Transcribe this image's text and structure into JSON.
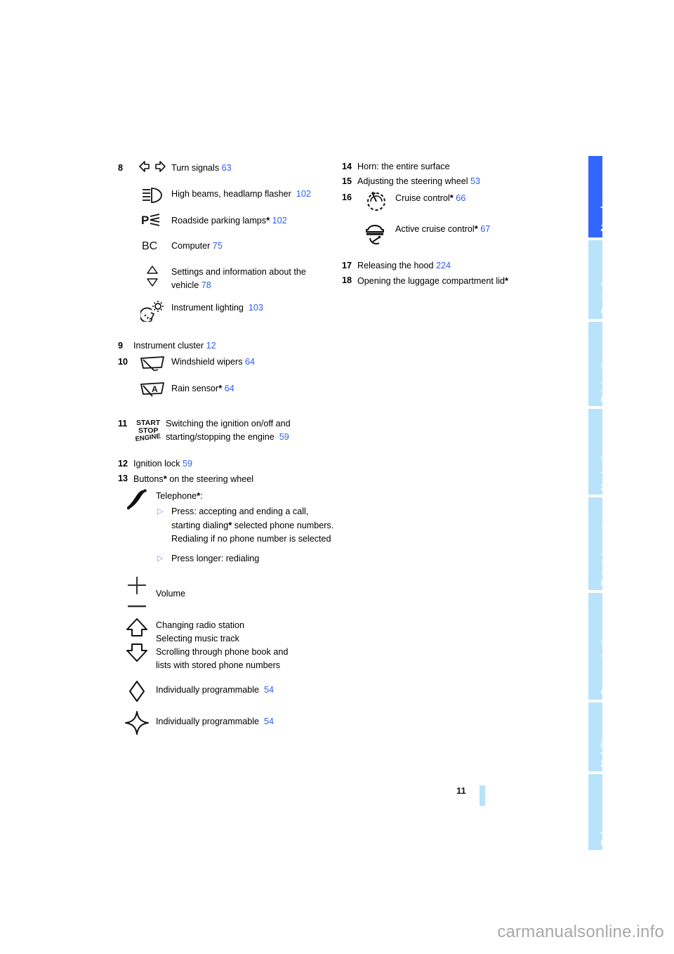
{
  "document": {
    "page_number": "11",
    "watermark": "carmanualsonline.info"
  },
  "sidebar": {
    "tabs": [
      {
        "label": "At a glance",
        "active": true
      },
      {
        "label": "Controls",
        "active": false
      },
      {
        "label": "Driving tips",
        "active": false
      },
      {
        "label": "Navigation",
        "active": false
      },
      {
        "label": "Entertainment",
        "active": false
      },
      {
        "label": "Communications",
        "active": false
      },
      {
        "label": "Mobility",
        "active": false
      },
      {
        "label": "Reference",
        "active": false
      }
    ],
    "active_color": "#3366ff",
    "inactive_color": "#b9e2fb"
  },
  "left_column": {
    "item8": {
      "number": "8",
      "entries": [
        {
          "icon": "turn-signals-icon",
          "text": "Turn signals",
          "page": "63",
          "starred": false
        },
        {
          "icon": "high-beam-icon",
          "text": "High beams, headlamp flasher",
          "page": "102",
          "starred": false
        },
        {
          "icon": "parking-lamp-icon",
          "text": "Roadside parking lamps",
          "page": "102",
          "starred": true
        },
        {
          "icon": "bc-computer-icon",
          "text": "Computer",
          "page": "75",
          "starred": false
        },
        {
          "icon": "up-down-arrows-icon",
          "text": "Settings and information about the vehicle",
          "page": "78",
          "starred": false
        },
        {
          "icon": "instrument-lighting-icon",
          "text": "Instrument lighting",
          "page": "103",
          "starred": false
        }
      ]
    },
    "item9": {
      "number": "9",
      "text": "Instrument cluster",
      "page": "12"
    },
    "item10": {
      "number": "10",
      "entries": [
        {
          "icon": "wiper-icon",
          "text": "Windshield wipers",
          "page": "64",
          "starred": false
        },
        {
          "icon": "rain-sensor-icon",
          "text": "Rain sensor",
          "page": "64",
          "starred": true
        }
      ]
    },
    "item11": {
      "number": "11",
      "icon": "start-stop-engine-icon",
      "text": "Switching the ignition on/off and starting/stopping the engine",
      "page": "59"
    },
    "item12": {
      "number": "12",
      "text": "Ignition lock",
      "page": "59"
    },
    "item13": {
      "number": "13",
      "heading": "Buttons",
      "heading_starred": true,
      "heading_rest": " on the steering wheel",
      "phone": {
        "icon": "telephone-icon",
        "label": "Telephone",
        "starred": true,
        "label_suffix": ":",
        "bullets": [
          "Press: accepting and ending a call, starting dialing* selected phone numbers. Redialing if no phone number is selected",
          "Press longer: redialing"
        ]
      },
      "volume": {
        "icon": "plus-minus-volume-icon",
        "text": "Volume"
      },
      "arrows": {
        "icon": "up-down-block-arrows-icon",
        "lines": [
          "Changing radio station",
          "Selecting music track",
          "Scrolling through phone book and",
          "lists with stored phone numbers"
        ]
      },
      "prog1": {
        "icon": "diamond-icon",
        "text": "Individually programmable",
        "page": "54"
      },
      "prog2": {
        "icon": "star-diamond-icon",
        "text": "Individually programmable",
        "page": "54"
      }
    }
  },
  "right_column": {
    "item14": {
      "number": "14",
      "text": "Horn: the entire surface"
    },
    "item15": {
      "number": "15",
      "text": "Adjusting the steering wheel",
      "page": "53"
    },
    "item16": {
      "number": "16",
      "entries": [
        {
          "icon": "cruise-control-icon",
          "text": "Cruise control",
          "page": "66",
          "starred": true
        },
        {
          "icon": "active-cruise-control-icon",
          "text": "Active cruise control",
          "page": "67",
          "starred": true
        }
      ]
    },
    "item17": {
      "number": "17",
      "text": "Releasing the hood",
      "page": "224"
    },
    "item18": {
      "number": "18",
      "text": "Opening the luggage compartment lid",
      "starred": true
    }
  }
}
